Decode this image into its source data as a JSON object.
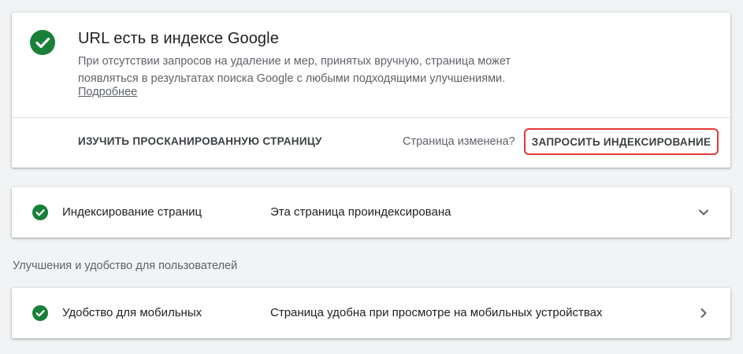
{
  "status": {
    "icon": "check-circle-icon",
    "title": "URL есть в индексе Google",
    "description": "При отсутствии запросов на удаление и мер, принятых вручную, страница может появляться в результатах поиска Google с любыми подходящими улучшениями.",
    "learn_more": "Подробнее",
    "inspect_button": "ИЗУЧИТЬ ПРОСКАНИРОВАННУЮ СТРАНИЦУ",
    "changed_label": "Страница изменена?",
    "request_button": "ЗАПРОСИТЬ ИНДЕКСИРОВАНИЕ"
  },
  "indexing_row": {
    "icon": "check-circle-icon",
    "name": "Индексирование страниц",
    "value": "Эта страница проиндексирована",
    "chevron": "chevron-down-icon"
  },
  "enhancements": {
    "section_label": "Улучшения и удобство для пользователей",
    "mobile_row": {
      "icon": "check-circle-icon",
      "name": "Удобство для мобильных",
      "value": "Страница удобна при просмотре на мобильных устройствах",
      "chevron": "chevron-right-icon"
    }
  },
  "colors": {
    "success_green": "#188038",
    "highlight_red": "#e53935",
    "page_background": "#f1f3f4"
  }
}
